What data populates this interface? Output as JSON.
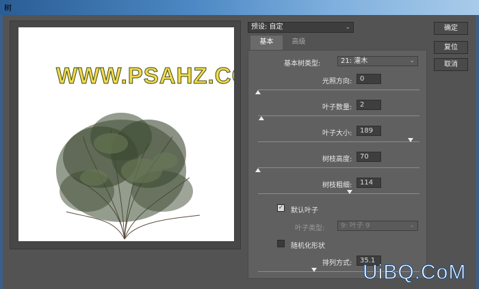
{
  "window": {
    "title": "树"
  },
  "preview": {
    "watermark": "WWW.PSAHZ.COM"
  },
  "preset": {
    "value": "预设: 自定"
  },
  "tabs": [
    {
      "label": "基本"
    },
    {
      "label": "高级"
    }
  ],
  "fields": {
    "tree_type": {
      "label": "基本树类型:",
      "value": "21: 灌木"
    },
    "light_direction": {
      "label": "光照方向:",
      "value": "0",
      "slider_fraction": 0.0
    },
    "leaf_count": {
      "label": "叶子数量:",
      "value": "2",
      "slider_fraction": 0.02
    },
    "leaf_size": {
      "label": "叶子大小:",
      "value": "189",
      "slider_fraction": 0.945
    },
    "branch_height": {
      "label": "树枝高度:",
      "value": "70",
      "slider_fraction": 0.0
    },
    "branch_thickness": {
      "label": "树枝粗细:",
      "value": "114",
      "slider_fraction": 0.57
    },
    "default_leaf": {
      "label": "默认叶子",
      "checked": true
    },
    "leaf_type": {
      "label": "叶子类型:",
      "value": "9: 叶子 9"
    },
    "randomize": {
      "label": "随机化形状",
      "checked": false
    },
    "arrangement": {
      "label": "排列方式:",
      "value": "35.1",
      "slider_fraction": 0.35
    }
  },
  "buttons": {
    "ok": "确定",
    "reset": "复位",
    "cancel": "取消"
  },
  "footer_watermark": "UiBQ.CoM"
}
